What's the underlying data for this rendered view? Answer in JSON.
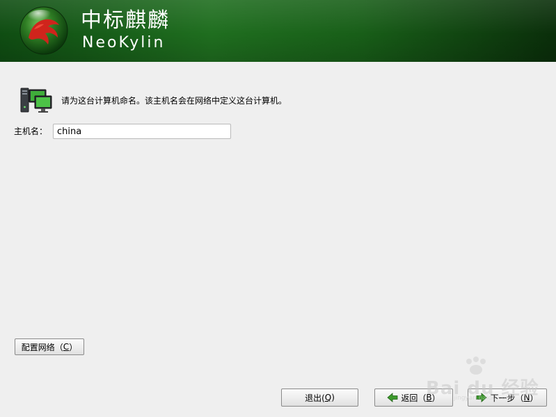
{
  "header": {
    "brand_cn": "中标麒麟",
    "brand_en": "NeoKylin",
    "logo_icon": "kylin-logo-icon",
    "colors": {
      "dark_green": "#0f4d12",
      "mid_green": "#1f6e1f",
      "orb_red": "#d0241c"
    }
  },
  "main": {
    "intro_icon": "computer-network-icon",
    "intro_text": "请为这台计算机命名。该主机名会在网络中定义这台计算机。",
    "hostname_label": "主机名：",
    "hostname_value": "china"
  },
  "buttons": {
    "configure_network": {
      "text": "配置网络（",
      "mnemonic": "C",
      "close": "）"
    },
    "quit": {
      "text": "退出(",
      "mnemonic": "Q",
      "close": ")"
    },
    "back": {
      "text": "返回（",
      "mnemonic": "B",
      "close": "）",
      "icon": "arrow-left-icon"
    },
    "next": {
      "text": "下一步（",
      "mnemonic": "N",
      "close": "）",
      "icon": "arrow-right-icon"
    }
  },
  "watermark": {
    "text": "Bai du 经验",
    "subtext": "jingyan.baidu.com"
  }
}
